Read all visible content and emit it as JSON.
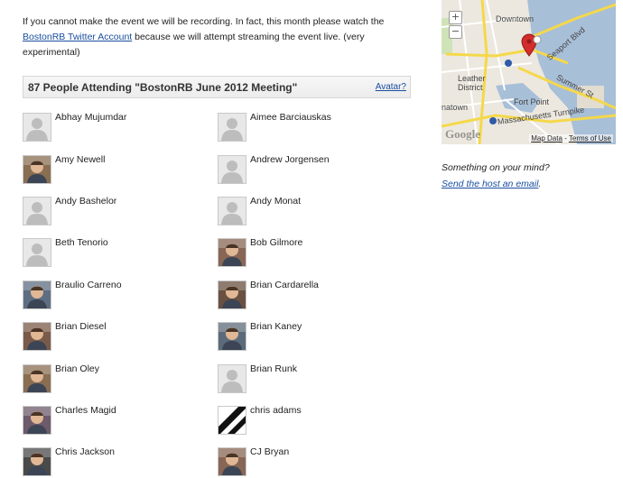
{
  "intro": {
    "text_before": "If you cannot make the event we will be recording. In fact, this month please watch the ",
    "link_text": "BostonRB Twitter Account",
    "text_after": " because we will attempt streaming the event live. (very experimental)"
  },
  "attendees": {
    "heading": "87 People Attending \"BostonRB June 2012 Meeting\"",
    "avatar_link": "Avatar?",
    "people": [
      {
        "name": "Abhay Mujumdar",
        "avatar": "default"
      },
      {
        "name": "Aimee Barciauskas",
        "avatar": "default"
      },
      {
        "name": "Amy Newell",
        "avatar": "photo"
      },
      {
        "name": "Andrew Jorgensen",
        "avatar": "default"
      },
      {
        "name": "Andy Bashelor",
        "avatar": "default"
      },
      {
        "name": "Andy Monat",
        "avatar": "default"
      },
      {
        "name": "Beth Tenorio",
        "avatar": "default"
      },
      {
        "name": "Bob Gilmore",
        "avatar": "photo"
      },
      {
        "name": "Braulio Carreno",
        "avatar": "photo"
      },
      {
        "name": "Brian Cardarella",
        "avatar": "photo"
      },
      {
        "name": "Brian Diesel",
        "avatar": "photo"
      },
      {
        "name": "Brian Kaney",
        "avatar": "photo"
      },
      {
        "name": "Brian Oley",
        "avatar": "photo"
      },
      {
        "name": "Brian Runk",
        "avatar": "default"
      },
      {
        "name": "Charles Magid",
        "avatar": "photo"
      },
      {
        "name": "chris adams",
        "avatar": "stripe"
      },
      {
        "name": "Chris Jackson",
        "avatar": "photo"
      },
      {
        "name": "CJ Bryan",
        "avatar": "photo"
      }
    ]
  },
  "map": {
    "zoom_in": "+",
    "zoom_out": "−",
    "labels": {
      "downtown": "Downtown",
      "leather": "Leather",
      "district": "District",
      "fort_point": "Fort Point",
      "seaport": "Seaport Blvd",
      "summer": "Summer St",
      "mass_pike": "Massachusetts Turnpike",
      "chinatown": "natown"
    },
    "logo": "Google",
    "map_data": "Map Data",
    "terms": "Terms of Use"
  },
  "sidebar": {
    "prompt": "Something on your mind?",
    "email_link": "Send the host an email"
  },
  "colors": {
    "link": "#1a4fa0",
    "header_bg": "#ececec",
    "road_yellow": "#f5d84a",
    "water": "#a8bfd8",
    "pin": "#d42b2b"
  }
}
